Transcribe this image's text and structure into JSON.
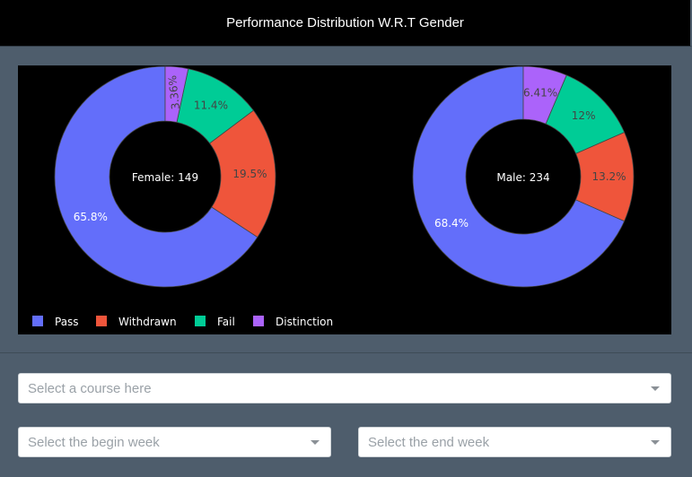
{
  "header": {
    "title": "Performance Distribution W.R.T Gender"
  },
  "chart_data": {
    "type": "pie",
    "hole": true,
    "legend_position": "bottom-left",
    "categories": [
      "Pass",
      "Withdrawn",
      "Fail",
      "Distinction"
    ],
    "colors": [
      "#636efa",
      "#ef553b",
      "#00cc96",
      "#ab63fa"
    ],
    "pies": [
      {
        "center_label": "Female: 149",
        "values": [
          65.8,
          19.5,
          11.4,
          3.36
        ],
        "labels": [
          "65.8%",
          "19.5%",
          "11.4%",
          "3.36%"
        ]
      },
      {
        "center_label": "Male: 234",
        "values": [
          68.4,
          13.2,
          12.0,
          6.41
        ],
        "labels": [
          "68.4%",
          "13.2%",
          "12%",
          "6.41%"
        ]
      }
    ]
  },
  "controls": {
    "course_placeholder": "Select a course here",
    "begin_week_placeholder": "Select the begin week",
    "end_week_placeholder": "Select the end week"
  }
}
